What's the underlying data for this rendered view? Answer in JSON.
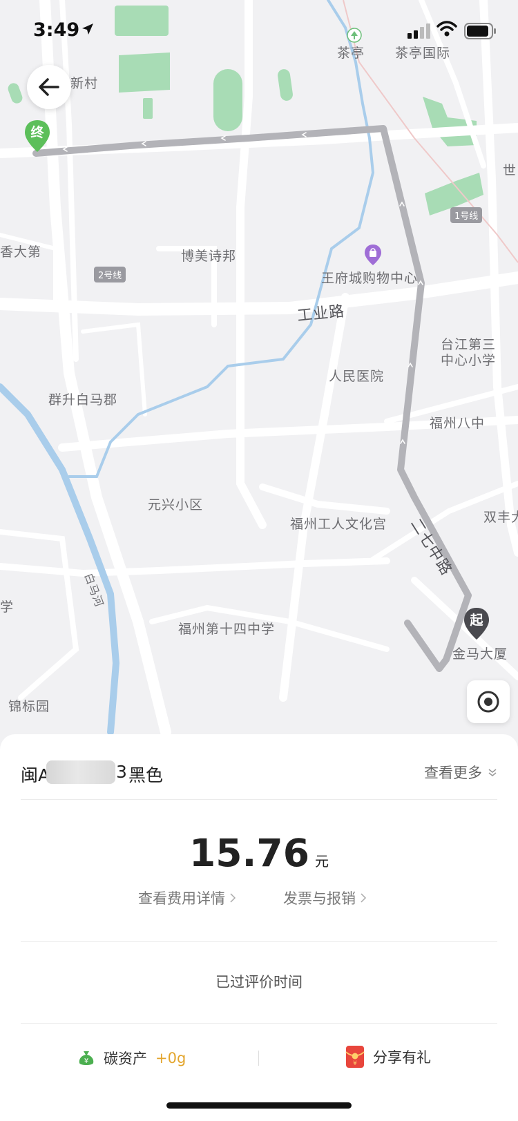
{
  "status_bar": {
    "time": "3:49"
  },
  "map": {
    "labels": {
      "chating": "茶亭",
      "chating_intl": "茶亭国际",
      "xincun": "新村",
      "shi": "世",
      "xiangdadi": "香大第",
      "bomei": "博美诗邦",
      "wangfujing": "王府城购物中心",
      "gongyelu": "工业路",
      "taijiang": "台江第三\n中心小学",
      "renmin": "人民医院",
      "qunsheng": "群升白马郡",
      "fuzhou8": "福州八中",
      "yuanxing": "元兴小区",
      "gongren": "福州工人文化宫",
      "shuangfeng": "双丰大",
      "erqi": "二七中路",
      "baimahe": "白马河",
      "xue": "学",
      "fuzhou14": "福州第十四中学",
      "jinma": "金马大厦",
      "jinbiao": "锦标园"
    },
    "lines": {
      "line1": "1号线",
      "line2": "2号线"
    },
    "pins": {
      "end": "终",
      "start": "起"
    }
  },
  "trip": {
    "plate_prefix": "闽A",
    "plate_suffix": "3",
    "car_color": "黑色",
    "more": "查看更多",
    "price": "15.76",
    "unit": "元",
    "fee_detail": "查看费用详情",
    "invoice": "发票与报销",
    "rated": "已过评价时间",
    "carbon_label": "碳资产",
    "carbon_value": "+0g",
    "share": "分享有礼"
  },
  "colors": {
    "park": "#a8dcb5",
    "route": "#b3b3b8",
    "end_pin": "#5cbf5a",
    "start_pin": "#4a4a4f",
    "river": "#a9cdeb",
    "accent": "#e3a52c"
  }
}
